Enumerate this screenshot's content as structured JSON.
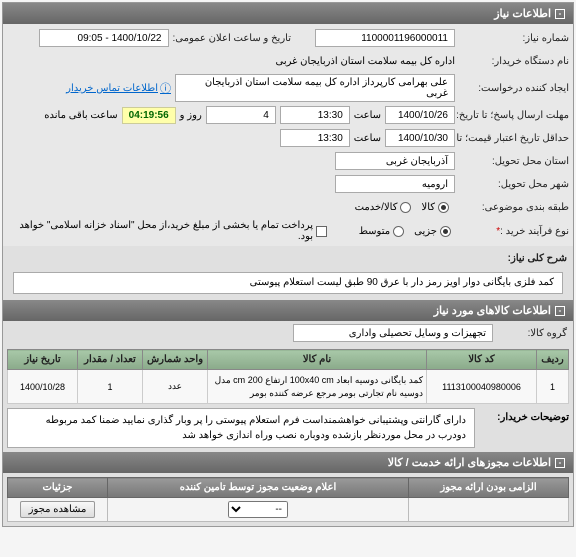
{
  "sections": {
    "info_header": "اطلاعات نیاز",
    "items_header": "اطلاعات کالاهای مورد نیاز",
    "permits_header": "اطلاعات مجوزهای ارائه خدمت / کالا"
  },
  "labels": {
    "need_number": "شماره نیاز:",
    "announce_datetime": "تاریخ و ساعت اعلان عمومی:",
    "buyer_org": "نام دستگاه خریدار:",
    "requester": "ایجاد کننده درخواست:",
    "response_deadline": "مهلت ارسال پاسخ؛ تا تاریخ:",
    "min_validity": "حداقل تاریخ اعتبار قیمت؛ تا تاریخ:",
    "province": "استان محل تحویل:",
    "city": "شهر محل تحویل:",
    "category": "طبقه بندی موضوعی:",
    "purchase_type": "نوع فرآیند خرید :",
    "hour": "ساعت",
    "day_and": "روز و",
    "remaining": "ساعت باقی مانده",
    "general_desc": "شرح کلی نیاز:",
    "product_group": "گروه کالا:",
    "buyer_notes": "توضیحات خریدار:",
    "contact": "اطلاعات تماس خریدار",
    "payment_note": "پرداخت تمام یا بخشی از مبلغ خرید،از محل \"اسناد خزانه اسلامی\" خواهد بود.",
    "view_permit": "مشاهده مجوز"
  },
  "values": {
    "need_number": "1100001196000011",
    "announce_datetime": "1400/10/22 - 09:05",
    "buyer_org": "اداره کل بیمه سلامت استان اذربایجان غربی",
    "requester": "علی بهرامی کارپرداز اداره کل بیمه سلامت استان اذربایجان غربی",
    "deadline_date": "1400/10/26",
    "deadline_time": "13:30",
    "countdown_days": "4",
    "countdown_time": "04:19:56",
    "validity_date": "1400/10/30",
    "validity_time": "13:30",
    "province": "آذربایجان غربی",
    "city": "ارومیه",
    "general_desc": "کمد فلزی بایگانی دوار اویز رمز دار با عرق 90 طبق لیست استعلام پیوستی",
    "product_group": "تجهیزات و وسایل تحصیلی واداری",
    "buyer_notes": "دارای گارانتی وپشتیبانی خواهشمنداست فرم استعلام پیوستی را پر وبار گذاری نمایید ضمنا کمد مربوطه دودرب در محل موردنظر بازشده ودوباره نصب وراه اندازی خواهد شد"
  },
  "categories": {
    "goods": "کالا",
    "goods_service": "کالا/خدمت"
  },
  "purchase_types": {
    "small": "جزیی",
    "medium": "متوسط"
  },
  "items_columns": {
    "row": "ردیف",
    "code": "کد کالا",
    "name": "نام کالا",
    "unit": "واحد شمارش",
    "qty": "تعداد / مقدار",
    "need_date": "تاریخ نیاز"
  },
  "items": [
    {
      "row": "1",
      "code": "1113100040980006",
      "name": "کمد بایگانی دوسیه ابعاد 100x40 cm ارتفاع 200 cm مدل دوسیه نام تجارتی بومر مرجع عرضه کننده بومر",
      "unit": "عدد",
      "qty": "1",
      "need_date": "1400/10/28"
    }
  ],
  "permit_columns": {
    "mandatory": "الزامی بودن ارائه مجوز",
    "status": "اعلام وضعیت مجوز توسط تامین کننده",
    "details": "جزئیات"
  },
  "permit_rows": [
    {
      "mandatory": "",
      "status_sel": "--"
    }
  ],
  "select_placeholder": "--"
}
